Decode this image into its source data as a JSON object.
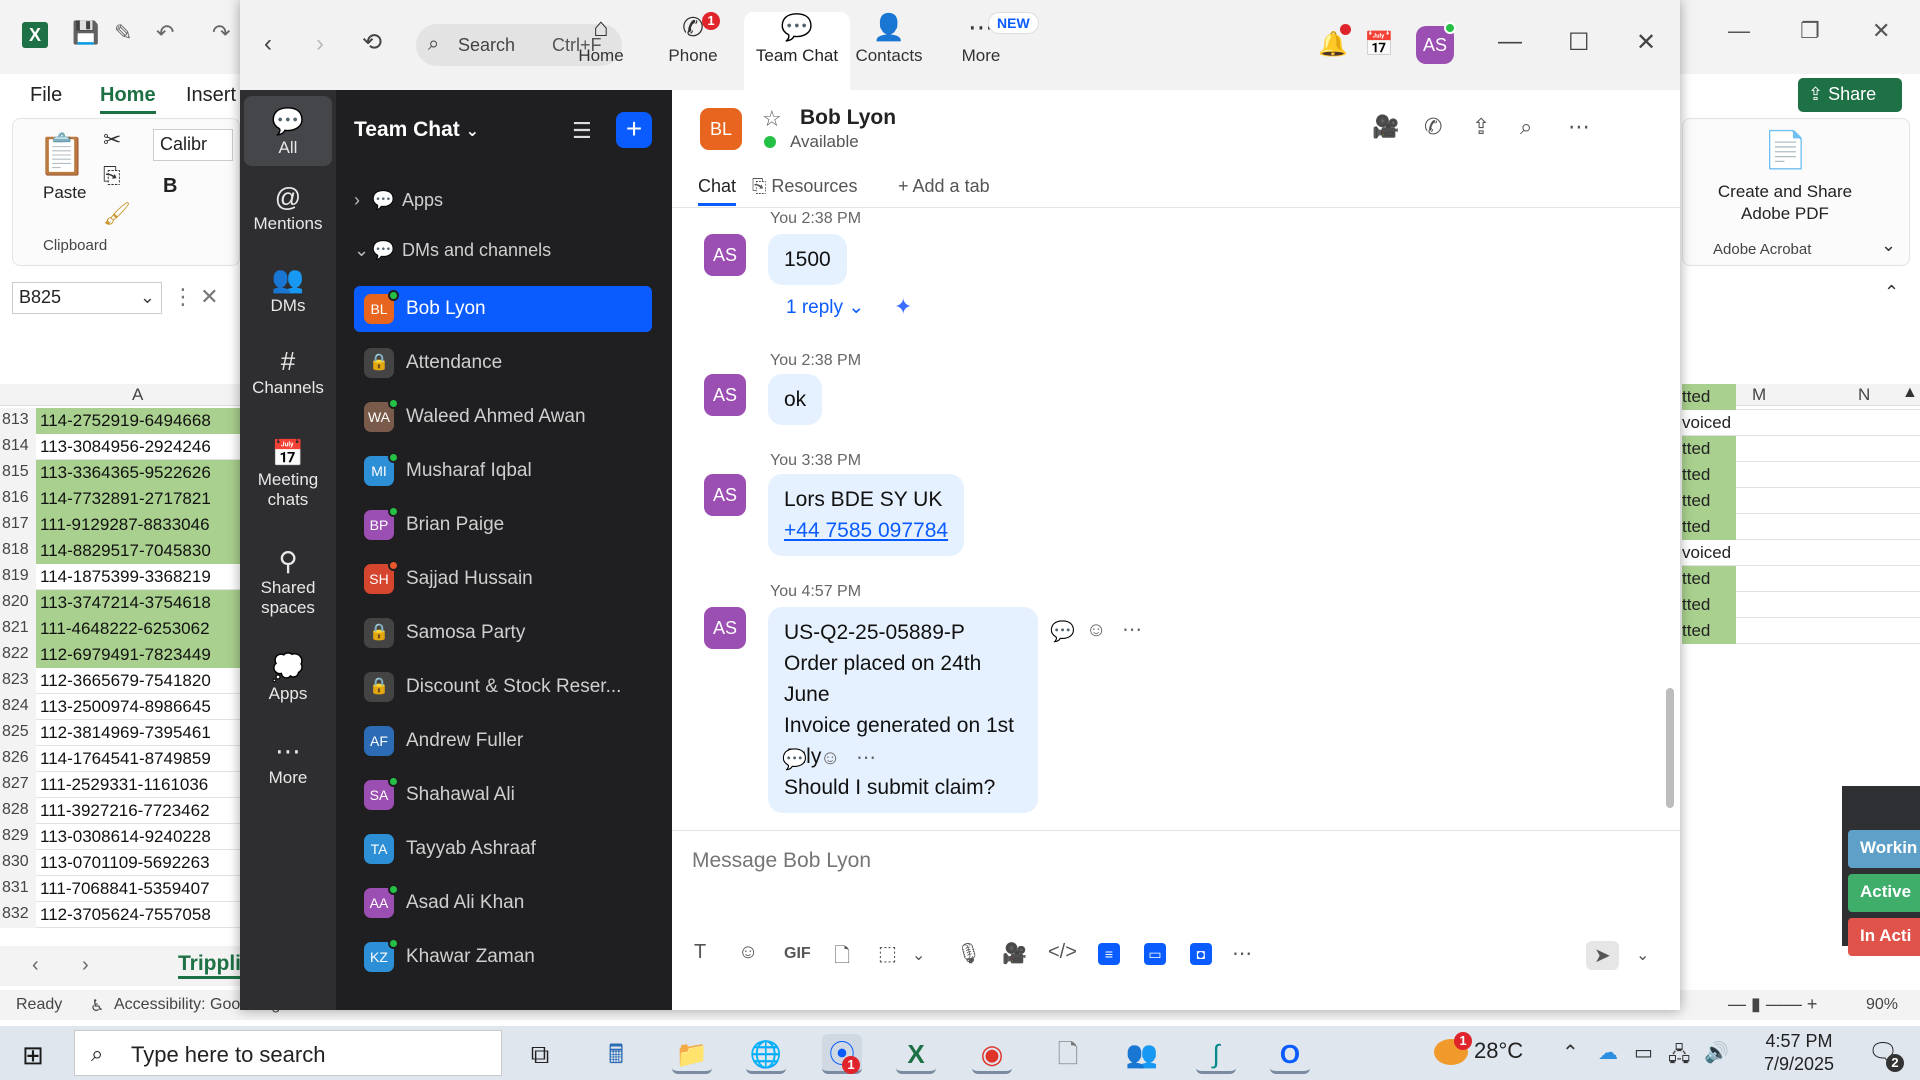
{
  "excel": {
    "app_icon": "X",
    "ribbon_tabs": [
      "File",
      "Home",
      "Insert"
    ],
    "share_label": "Share",
    "paste_label": "Paste",
    "clipboard_label": "Clipboard",
    "font_name": "Calibr",
    "bold": "B",
    "name_box": "B825",
    "col_a": "A",
    "col_m": "M",
    "col_n": "N",
    "adobe_line1": "Create and Share",
    "adobe_line2": "Adobe PDF",
    "adobe_group": "Adobe Acrobat",
    "rows": [
      {
        "num": "813",
        "val": "114-2752919-6494668",
        "green": true
      },
      {
        "num": "814",
        "val": "113-3084956-2924246",
        "green": false
      },
      {
        "num": "815",
        "val": "113-3364365-9522626",
        "green": true
      },
      {
        "num": "816",
        "val": "114-7732891-2717821",
        "green": true
      },
      {
        "num": "817",
        "val": "111-9129287-8833046",
        "green": true
      },
      {
        "num": "818",
        "val": "114-8829517-7045830",
        "green": true
      },
      {
        "num": "819",
        "val": "114-1875399-3368219",
        "green": false
      },
      {
        "num": "820",
        "val": "113-3747214-3754618",
        "green": true
      },
      {
        "num": "821",
        "val": "111-4648222-6253062",
        "green": true
      },
      {
        "num": "822",
        "val": "112-6979491-7823449",
        "green": true
      },
      {
        "num": "823",
        "val": "112-3665679-7541820",
        "green": false
      },
      {
        "num": "824",
        "val": "113-2500974-8986645",
        "green": false
      },
      {
        "num": "825",
        "val": "112-3814969-7395461",
        "green": false
      },
      {
        "num": "826",
        "val": "114-1764541-8749859",
        "green": false
      },
      {
        "num": "827",
        "val": "111-2529331-1161036",
        "green": false
      },
      {
        "num": "828",
        "val": "111-3927216-7723462",
        "green": false
      },
      {
        "num": "829",
        "val": "113-0308614-9240228",
        "green": false
      },
      {
        "num": "830",
        "val": "113-0701109-5692263",
        "green": false
      },
      {
        "num": "831",
        "val": "111-7068841-5359407",
        "green": false
      },
      {
        "num": "832",
        "val": "112-3705624-7557058",
        "green": false
      }
    ],
    "right_cells": [
      {
        "val": "tted",
        "green": true
      },
      {
        "val": "voiced yet",
        "green": false
      },
      {
        "val": "tted",
        "green": true
      },
      {
        "val": "tted",
        "green": true
      },
      {
        "val": "tted",
        "green": true
      },
      {
        "val": "tted",
        "green": true
      },
      {
        "val": "voiced yet",
        "green": false
      },
      {
        "val": "tted",
        "green": true
      },
      {
        "val": "tted",
        "green": true
      },
      {
        "val": "tted",
        "green": true
      }
    ],
    "sheet_tab": "Trippli",
    "status_ready": "Ready",
    "status_accessibility": "Accessibility: Good to go",
    "zoom_level": "90%",
    "status_pills": [
      {
        "label": "Workin",
        "color": "#5fa0c9"
      },
      {
        "label": "Active",
        "color": "#3fae6a"
      },
      {
        "label": "In Acti",
        "color": "#e0534b"
      }
    ]
  },
  "zoom": {
    "search": {
      "placeholder": "Search",
      "shortcut": "Ctrl+F"
    },
    "nav_tabs": [
      {
        "label": "Home",
        "icon": "home-icon",
        "glyph": "⌂"
      },
      {
        "label": "Phone",
        "icon": "phone-icon",
        "glyph": "✆",
        "badge": "1"
      },
      {
        "label": "Team Chat",
        "icon": "team-chat-icon",
        "glyph": "💬"
      },
      {
        "label": "Contacts",
        "icon": "contacts-icon",
        "glyph": "👤"
      },
      {
        "label": "More",
        "icon": "more-icon",
        "glyph": "⋯",
        "tag": "NEW"
      }
    ],
    "my_initials": "AS",
    "rail": [
      {
        "label": "All",
        "glyph": "💬",
        "icon": "all-chats-icon"
      },
      {
        "label": "Mentions",
        "glyph": "@",
        "icon": "mentions-icon"
      },
      {
        "label": "DMs",
        "glyph": "👥",
        "icon": "dms-icon"
      },
      {
        "label": "Channels",
        "glyph": "#",
        "icon": "channels-icon"
      },
      {
        "label": "Meeting chats",
        "glyph": "📅",
        "icon": "meeting-chats-icon"
      },
      {
        "label": "Shared spaces",
        "glyph": "⚲",
        "icon": "shared-spaces-icon"
      },
      {
        "label": "Apps",
        "glyph": "💭",
        "icon": "apps-icon"
      },
      {
        "label": "More",
        "glyph": "⋯",
        "icon": "more-icon"
      }
    ],
    "list_title": "Team Chat",
    "sections": {
      "apps": "Apps",
      "dms": "DMs and channels"
    },
    "channels": [
      {
        "name": "Bob Lyon",
        "initials": "BL",
        "color": "#e8651f",
        "status": "green",
        "active": true
      },
      {
        "name": "Attendance",
        "initials": "🔒",
        "color": "#444",
        "lock": true
      },
      {
        "name": "Waleed Ahmed Awan",
        "initials": "WA",
        "color": "#7a5a4a",
        "status": "green"
      },
      {
        "name": "Musharaf Iqbal",
        "initials": "MI",
        "color": "#2d8fd6",
        "status": "green"
      },
      {
        "name": "Brian Paige",
        "initials": "BP",
        "color": "#9c4fb3",
        "status": "green"
      },
      {
        "name": "Sajjad Hussain",
        "initials": "SH",
        "color": "#d6452d",
        "status": "red"
      },
      {
        "name": "Samosa Party",
        "initials": "🔒",
        "color": "#444",
        "lock": true
      },
      {
        "name": "Discount & Stock Reser...",
        "initials": "🔒",
        "color": "#444",
        "lock": true
      },
      {
        "name": "Andrew Fuller",
        "initials": "AF",
        "color": "#2b6cb5"
      },
      {
        "name": "Shahawal Ali",
        "initials": "SA",
        "color": "#9c4fb3",
        "status": "green"
      },
      {
        "name": "Tayyab Ashraaf",
        "initials": "TA",
        "color": "#2d8fd6"
      },
      {
        "name": "Asad Ali Khan",
        "initials": "AA",
        "color": "#9c4fb3",
        "status": "green"
      },
      {
        "name": "Khawar Zaman",
        "initials": "KZ",
        "color": "#2d8fd6",
        "status": "green"
      }
    ],
    "chat": {
      "name": "Bob Lyon",
      "initials": "BL",
      "status": "Available",
      "tabs": [
        "Chat",
        "Resources",
        "Add a tab"
      ],
      "composer_placeholder": "Message Bob Lyon",
      "messages": [
        {
          "meta": "You 2:38 PM",
          "initials": "AS",
          "lines": [
            "1500"
          ],
          "reply": "1 reply"
        },
        {
          "meta": "You 2:38 PM",
          "initials": "AS",
          "lines": [
            "ok"
          ]
        },
        {
          "meta": "You 3:38 PM",
          "initials": "AS",
          "lines": [
            "Lors BDE SY UK"
          ],
          "phone": "+44 7585 097784"
        },
        {
          "meta": "You 4:57 PM",
          "initials": "AS",
          "lines": [
            "US-Q2-25-05889-P",
            "Order placed on 24th June",
            "Invoice generated on 1st July",
            "Should I submit claim?"
          ]
        }
      ]
    }
  },
  "taskbar": {
    "search_placeholder": "Type here to search",
    "temperature": "28°C",
    "time": "4:57 PM",
    "date": "7/9/2025",
    "notifications": "2",
    "zoom_badge": "1",
    "weather_badge": "1"
  }
}
